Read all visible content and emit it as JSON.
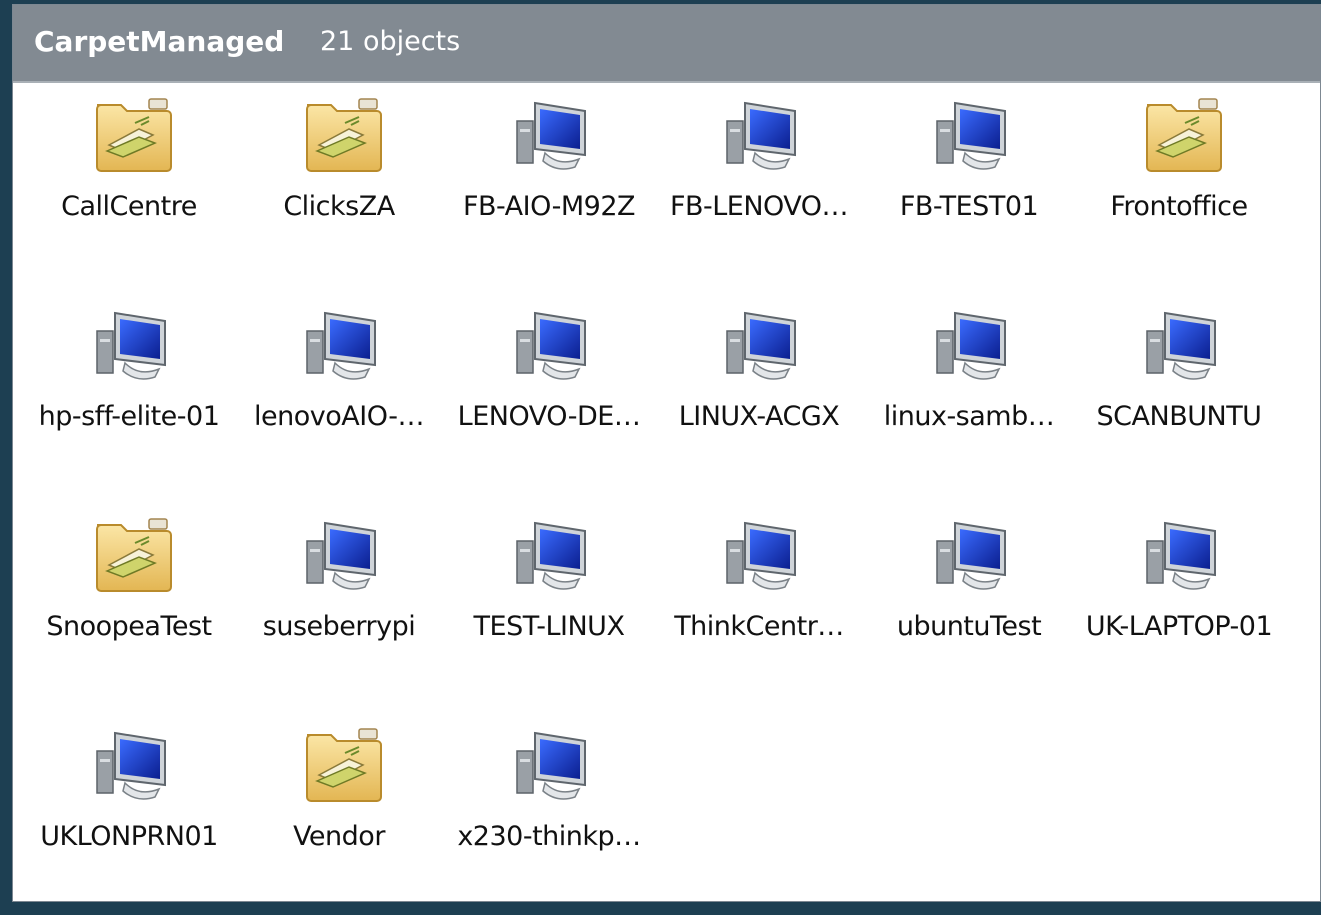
{
  "window": {
    "title": "CarpetManaged",
    "object_count": "21 objects"
  },
  "items": [
    {
      "label": "CallCentre",
      "icon": "folder-icon"
    },
    {
      "label": "ClicksZA",
      "icon": "folder-icon"
    },
    {
      "label": "FB-AIO-M92Z",
      "icon": "computer-icon"
    },
    {
      "label": "FB-LENOVO…",
      "icon": "computer-icon"
    },
    {
      "label": "FB-TEST01",
      "icon": "computer-icon"
    },
    {
      "label": "Frontoffice",
      "icon": "folder-icon"
    },
    {
      "label": "hp-sff-elite-01",
      "icon": "computer-icon"
    },
    {
      "label": "lenovoAIO-…",
      "icon": "computer-icon"
    },
    {
      "label": "LENOVO-DE…",
      "icon": "computer-icon"
    },
    {
      "label": "LINUX-ACGX",
      "icon": "computer-icon"
    },
    {
      "label": "linux-samb…",
      "icon": "computer-icon"
    },
    {
      "label": "SCANBUNTU",
      "icon": "computer-icon"
    },
    {
      "label": "SnoopeaTest",
      "icon": "folder-icon"
    },
    {
      "label": "suseberrypi",
      "icon": "computer-icon"
    },
    {
      "label": "TEST-LINUX",
      "icon": "computer-icon"
    },
    {
      "label": "ThinkCentr…",
      "icon": "computer-icon"
    },
    {
      "label": "ubuntuTest",
      "icon": "computer-icon"
    },
    {
      "label": "UK-LAPTOP-01",
      "icon": "computer-icon"
    },
    {
      "label": "UKLONPRN01",
      "icon": "computer-icon"
    },
    {
      "label": "Vendor",
      "icon": "folder-icon"
    },
    {
      "label": "x230-thinkp…",
      "icon": "computer-icon"
    }
  ],
  "colors": {
    "desktop_background": "#1d3f52",
    "title_bar": "#828a92",
    "folder": "#f1d17f",
    "screen": "#1d3fd2"
  }
}
